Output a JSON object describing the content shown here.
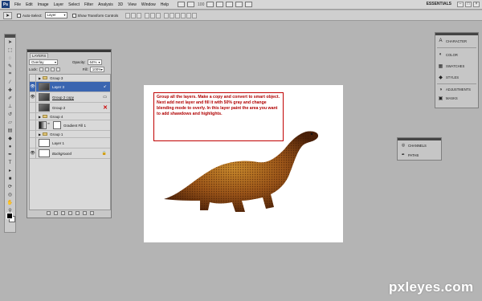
{
  "menubar": {
    "logo": "Ps",
    "items": [
      "File",
      "Edit",
      "Image",
      "Layer",
      "Select",
      "Filter",
      "Analysis",
      "3D",
      "View",
      "Window",
      "Help"
    ],
    "zoom": "100",
    "workspace": "ESSENTIALS",
    "window_buttons": [
      "–",
      "□",
      "×"
    ]
  },
  "options_bar": {
    "auto_select_label": "Auto-Select:",
    "auto_select_value": "Layer",
    "show_transform_label": "Show Transform Controls"
  },
  "layers_panel": {
    "tab_label": "LAYERS",
    "blend_mode": "Overlay",
    "opacity_label": "Opacity:",
    "opacity_value": "64%",
    "lock_label": "Lock:",
    "fill_label": "Fill:",
    "fill_value": "100%",
    "layers": [
      {
        "name": "Group 3",
        "type": "group"
      },
      {
        "name": "Layer 3",
        "type": "layer",
        "selected": true
      },
      {
        "name": "Group 2 copy",
        "type": "smart"
      },
      {
        "name": "Group 2",
        "type": "smart"
      },
      {
        "name": "Group 4",
        "type": "group"
      },
      {
        "name": "Gradient Fill 1",
        "type": "fill"
      },
      {
        "name": "Group 1",
        "type": "group"
      },
      {
        "name": "Layer 1",
        "type": "layer"
      },
      {
        "name": "Background",
        "type": "background"
      }
    ]
  },
  "canvas": {
    "note": "Group all the layers. Make a copy and convert to smart object. Next add next layer and fill it with 50% gray and change blending mode to overly. In this layer paint the area you want to add shawdows and highlights."
  },
  "right_panel": {
    "items": [
      {
        "label": "CHARACTER",
        "icon": "character-icon"
      },
      {
        "label": "COLOR",
        "icon": "color-icon"
      },
      {
        "label": "SWATCHES",
        "icon": "swatches-icon"
      },
      {
        "label": "STYLES",
        "icon": "styles-icon"
      },
      {
        "label": "ADJUSTMENTS",
        "icon": "adjustments-icon"
      },
      {
        "label": "MASKS",
        "icon": "masks-icon"
      }
    ]
  },
  "channels_panel": {
    "items": [
      "CHANNELS",
      "PATHS"
    ]
  },
  "watermark": "pxleyes.com",
  "colors": {
    "workspace_bg": "#b4b4b4",
    "note_red": "#c00000",
    "selected_layer": "#3a65b0"
  }
}
